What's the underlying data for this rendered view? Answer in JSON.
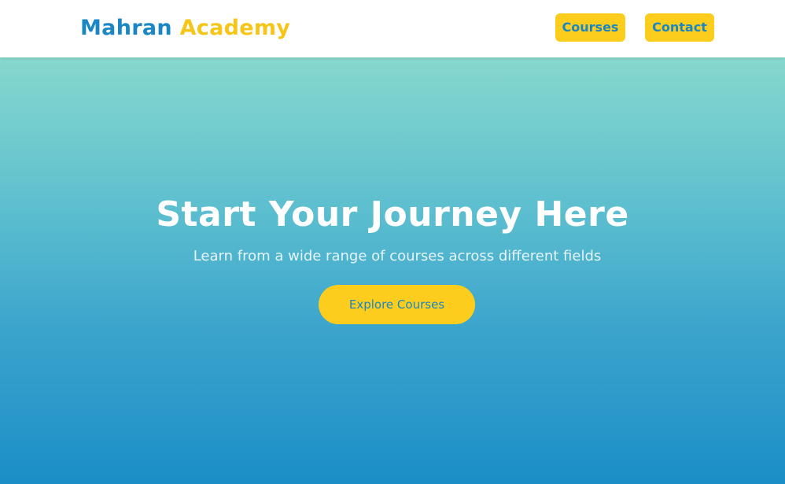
{
  "header": {
    "logo_part1": "Mahran",
    "logo_part2": "Academy",
    "nav": {
      "courses_label": "Courses",
      "contact_label": "Contact"
    }
  },
  "hero": {
    "title": "Start Your Journey Here",
    "subtitle": "Learn from a wide range of courses across different fields",
    "cta_label": "Explore Courses"
  },
  "colors": {
    "brand_blue": "#1a87c4",
    "brand_yellow": "#fccd1c",
    "hero_top": "#87d8cd",
    "hero_bottom": "#1b8ec7"
  }
}
